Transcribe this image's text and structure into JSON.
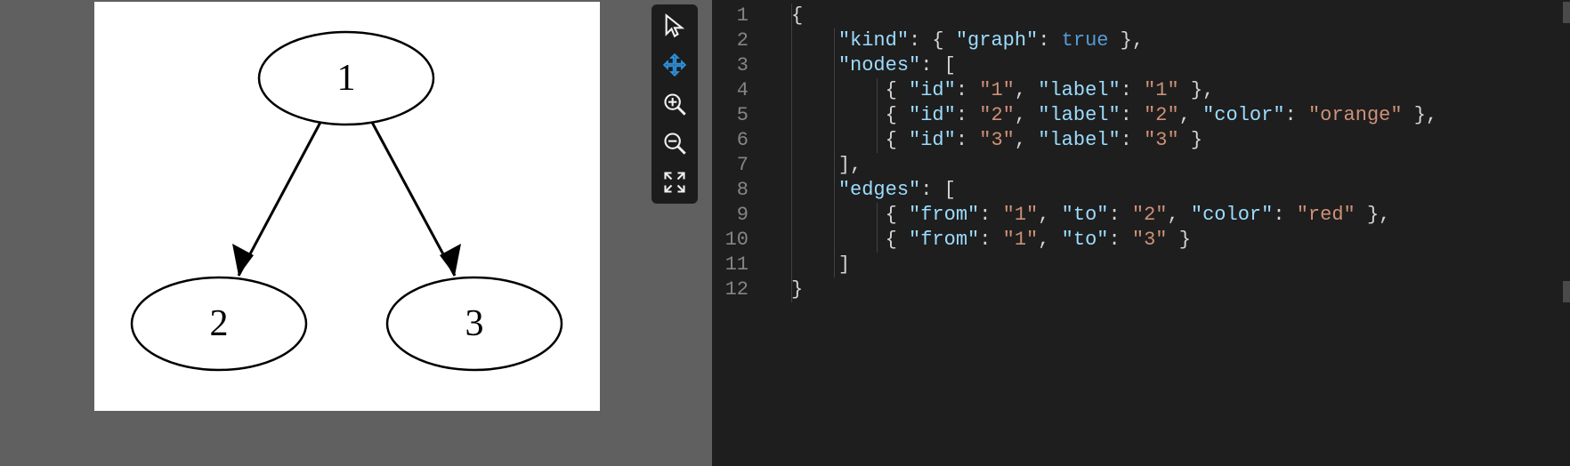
{
  "graph": {
    "nodes": [
      {
        "id": "1",
        "label": "1"
      },
      {
        "id": "2",
        "label": "2"
      },
      {
        "id": "3",
        "label": "3"
      }
    ],
    "edges": [
      {
        "from": "1",
        "to": "2"
      },
      {
        "from": "1",
        "to": "3"
      }
    ]
  },
  "toolbar": {
    "items": [
      {
        "name": "pointer-icon",
        "active": false
      },
      {
        "name": "move-icon",
        "active": true
      },
      {
        "name": "zoom-in-icon",
        "active": false
      },
      {
        "name": "zoom-out-icon",
        "active": false
      },
      {
        "name": "fit-icon",
        "active": false
      }
    ]
  },
  "editor": {
    "line_numbers": [
      "1",
      "2",
      "3",
      "4",
      "5",
      "6",
      "7",
      "8",
      "9",
      "10",
      "11",
      "12"
    ],
    "json_source": {
      "kind": {
        "graph": true
      },
      "nodes": [
        {
          "id": "1",
          "label": "1"
        },
        {
          "id": "2",
          "label": "2",
          "color": "orange"
        },
        {
          "id": "3",
          "label": "3"
        }
      ],
      "edges": [
        {
          "from": "1",
          "to": "2",
          "color": "red"
        },
        {
          "from": "1",
          "to": "3"
        }
      ]
    },
    "tokens": [
      [
        {
          "t": "brace",
          "v": "{"
        }
      ],
      [
        {
          "t": "sp",
          "v": "    "
        },
        {
          "t": "key",
          "v": "\"kind\""
        },
        {
          "t": "punc",
          "v": ": { "
        },
        {
          "t": "key",
          "v": "\"graph\""
        },
        {
          "t": "punc",
          "v": ": "
        },
        {
          "t": "bool",
          "v": "true"
        },
        {
          "t": "punc",
          "v": " },"
        }
      ],
      [
        {
          "t": "sp",
          "v": "    "
        },
        {
          "t": "key",
          "v": "\"nodes\""
        },
        {
          "t": "punc",
          "v": ": ["
        }
      ],
      [
        {
          "t": "sp",
          "v": "        "
        },
        {
          "t": "punc",
          "v": "{ "
        },
        {
          "t": "key",
          "v": "\"id\""
        },
        {
          "t": "punc",
          "v": ": "
        },
        {
          "t": "str",
          "v": "\"1\""
        },
        {
          "t": "punc",
          "v": ", "
        },
        {
          "t": "key",
          "v": "\"label\""
        },
        {
          "t": "punc",
          "v": ": "
        },
        {
          "t": "str",
          "v": "\"1\""
        },
        {
          "t": "punc",
          "v": " },"
        }
      ],
      [
        {
          "t": "sp",
          "v": "        "
        },
        {
          "t": "punc",
          "v": "{ "
        },
        {
          "t": "key",
          "v": "\"id\""
        },
        {
          "t": "punc",
          "v": ": "
        },
        {
          "t": "str",
          "v": "\"2\""
        },
        {
          "t": "punc",
          "v": ", "
        },
        {
          "t": "key",
          "v": "\"label\""
        },
        {
          "t": "punc",
          "v": ": "
        },
        {
          "t": "str",
          "v": "\"2\""
        },
        {
          "t": "punc",
          "v": ", "
        },
        {
          "t": "key",
          "v": "\"color\""
        },
        {
          "t": "punc",
          "v": ": "
        },
        {
          "t": "str",
          "v": "\"orange\""
        },
        {
          "t": "punc",
          "v": " },"
        }
      ],
      [
        {
          "t": "sp",
          "v": "        "
        },
        {
          "t": "punc",
          "v": "{ "
        },
        {
          "t": "key",
          "v": "\"id\""
        },
        {
          "t": "punc",
          "v": ": "
        },
        {
          "t": "str",
          "v": "\"3\""
        },
        {
          "t": "punc",
          "v": ", "
        },
        {
          "t": "key",
          "v": "\"label\""
        },
        {
          "t": "punc",
          "v": ": "
        },
        {
          "t": "str",
          "v": "\"3\""
        },
        {
          "t": "punc",
          "v": " }"
        }
      ],
      [
        {
          "t": "sp",
          "v": "    "
        },
        {
          "t": "punc",
          "v": "],"
        }
      ],
      [
        {
          "t": "sp",
          "v": "    "
        },
        {
          "t": "key",
          "v": "\"edges\""
        },
        {
          "t": "punc",
          "v": ": ["
        }
      ],
      [
        {
          "t": "sp",
          "v": "        "
        },
        {
          "t": "punc",
          "v": "{ "
        },
        {
          "t": "key",
          "v": "\"from\""
        },
        {
          "t": "punc",
          "v": ": "
        },
        {
          "t": "str",
          "v": "\"1\""
        },
        {
          "t": "punc",
          "v": ", "
        },
        {
          "t": "key",
          "v": "\"to\""
        },
        {
          "t": "punc",
          "v": ": "
        },
        {
          "t": "str",
          "v": "\"2\""
        },
        {
          "t": "punc",
          "v": ", "
        },
        {
          "t": "key",
          "v": "\"color\""
        },
        {
          "t": "punc",
          "v": ": "
        },
        {
          "t": "str",
          "v": "\"red\""
        },
        {
          "t": "punc",
          "v": " },"
        }
      ],
      [
        {
          "t": "sp",
          "v": "        "
        },
        {
          "t": "punc",
          "v": "{ "
        },
        {
          "t": "key",
          "v": "\"from\""
        },
        {
          "t": "punc",
          "v": ": "
        },
        {
          "t": "str",
          "v": "\"1\""
        },
        {
          "t": "punc",
          "v": ", "
        },
        {
          "t": "key",
          "v": "\"to\""
        },
        {
          "t": "punc",
          "v": ": "
        },
        {
          "t": "str",
          "v": "\"3\""
        },
        {
          "t": "punc",
          "v": " }"
        }
      ],
      [
        {
          "t": "sp",
          "v": "    "
        },
        {
          "t": "punc",
          "v": "]"
        }
      ],
      [
        {
          "t": "brace",
          "v": "}"
        }
      ]
    ]
  }
}
